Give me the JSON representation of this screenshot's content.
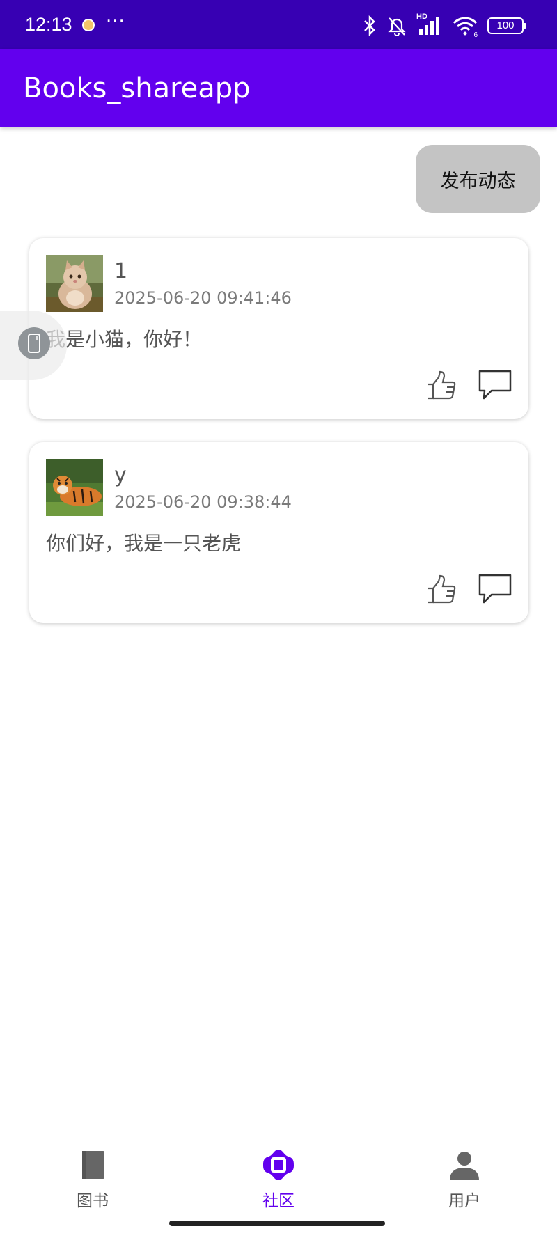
{
  "status_bar": {
    "time": "12:13",
    "dots": "···",
    "battery": "100",
    "hd_label": "HD",
    "wifi_label": "6"
  },
  "app_bar": {
    "title": "Books_shareapp"
  },
  "publish_button": {
    "label": "发布动态"
  },
  "posts": [
    {
      "user": "1",
      "time": "2025-06-20 09:41:46",
      "content": "我是小猫，你好！",
      "avatar_icon": "cat-avatar"
    },
    {
      "user": "y",
      "time": "2025-06-20 09:38:44",
      "content": "你们好，我是一只老虎",
      "avatar_icon": "tiger-avatar"
    }
  ],
  "bottom_nav": {
    "items": [
      {
        "label": "图书",
        "icon": "book-icon",
        "active": false
      },
      {
        "label": "社区",
        "icon": "community-icon",
        "active": true
      },
      {
        "label": "用户",
        "icon": "user-icon",
        "active": false
      }
    ]
  },
  "colors": {
    "status_bar": "#3700b3",
    "app_bar": "#6200ee",
    "active_nav": "#6200ee",
    "publish_button": "#c4c4c4"
  }
}
